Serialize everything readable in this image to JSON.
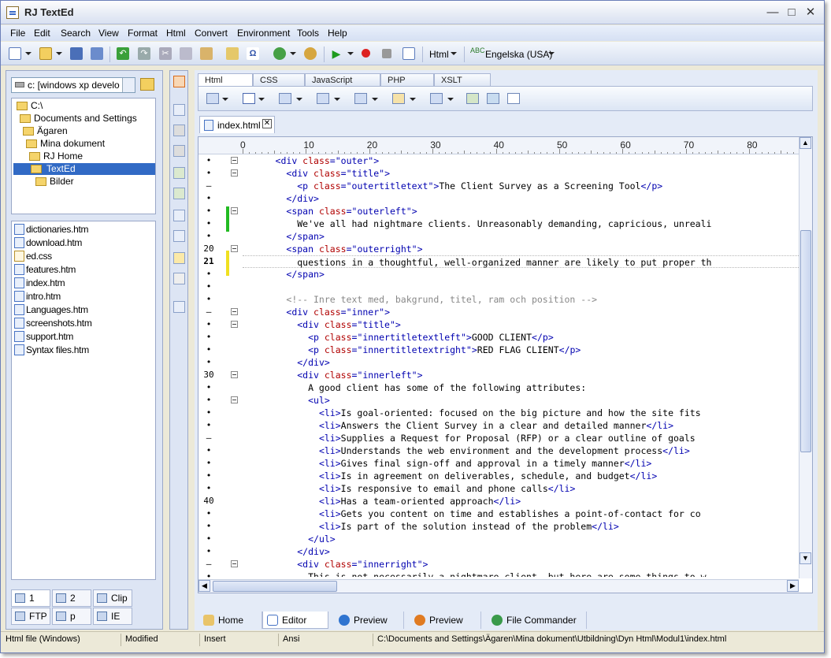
{
  "window": {
    "title": "RJ TextEd"
  },
  "menu": [
    "File",
    "Edit",
    "Search",
    "View",
    "Format",
    "Html",
    "Convert",
    "Environment",
    "Tools",
    "Help"
  ],
  "toolbar": {
    "mode_label": "Html",
    "language_label": "Engelska (USA)"
  },
  "left_panel": {
    "drive_value": "c: [windows xp develo",
    "tree": [
      "C:\\",
      "Documents and Settings",
      "Ägaren",
      "Mina dokument",
      "RJ Home",
      "TextEd",
      "Bilder"
    ],
    "tree_selected": "TextEd",
    "files": [
      "dictionaries.htm",
      "download.htm",
      "ed.css",
      "features.htm",
      "index.htm",
      "intro.htm",
      "Languages.htm",
      "screenshots.htm",
      "support.htm",
      "Syntax files.htm"
    ],
    "tabs": [
      "1",
      "2",
      "Clip",
      "FTP",
      "p",
      "IE"
    ]
  },
  "editor": {
    "panel_tabs": [
      "Html",
      "CSS",
      "JavaScript",
      "PHP",
      "XSLT"
    ],
    "active_panel_tab": "Html",
    "doc_tab": "index.html",
    "ruler_numbers": [
      "0",
      "10",
      "20",
      "30",
      "40",
      "50",
      "60",
      "70",
      "80"
    ],
    "gutter": [
      "•",
      "•",
      "–",
      "•",
      "•",
      "•",
      "•",
      "20",
      "21",
      "•",
      "•",
      "•",
      "–",
      "•",
      "•",
      "•",
      "•",
      "30",
      "•",
      "•",
      "•",
      "•",
      "–",
      "•",
      "•",
      "•",
      "•",
      "40",
      "•",
      "•",
      "•",
      "•",
      "–",
      "•"
    ],
    "current_line": "21",
    "code_lines": [
      "<div class=\"outer\">",
      "  <div class=\"title\">",
      "    <p class=\"outertitletext\">The Client Survey as a Screening Tool</p>",
      "  </div>",
      "  <span class=\"outerleft\">",
      "    We've all had nightmare clients. Unreasonably demanding, capricious, unreali",
      "  </span>",
      "  <span class=\"outerright\">",
      "    questions in a thoughtful, well-organized manner are likely to put proper th",
      "  </span>",
      "",
      "  <!-- Inre text med, bakgrund, titel, ram och position -->",
      "  <div class=\"inner\">",
      "    <div class=\"title\">",
      "      <p class=\"innertitletextleft\">GOOD CLIENT</p>",
      "      <p class=\"innertitletextright\">RED FLAG CLIENT</p>",
      "    </div>",
      "    <div class=\"innerleft\">",
      "      A good client has some of the following attributes:",
      "      <ul>",
      "        <li>Is goal-oriented: focused on the big picture and how the site fits",
      "        <li>Answers the Client Survey in a clear and detailed manner</li>",
      "        <li>Supplies a Request for Proposal (RFP) or a clear outline of goals",
      "        <li>Understands the web environment and the development process</li>",
      "        <li>Gives final sign-off and approval in a timely manner</li>",
      "        <li>Is in agreement on deliverables, schedule, and budget</li>",
      "        <li>Is responsive to email and phone calls</li>",
      "        <li>Has a team-oriented approach</li>",
      "        <li>Gets you content on time and establishes a point-of-contact for co",
      "        <li>Is part of the solution instead of the problem</li>",
      "      </ul>",
      "    </div>",
      "    <div class=\"innerright\">",
      "      This is not necessarily a nightmare client, but here are some things to w"
    ]
  },
  "bottom_tabs": [
    "Home",
    "Editor",
    "Preview",
    "Preview",
    "File Commander"
  ],
  "active_bottom_tab": "Editor",
  "status": {
    "file_type": "Html file (Windows)",
    "modified": "Modified",
    "insert": "Insert",
    "encoding": "Ansi",
    "path": "C:\\Documents and Settings\\Ägaren\\Mina dokument\\Utbildning\\Dyn Html\\Modul1\\index.html"
  },
  "colors": {
    "tag": "#0000b0",
    "attr": "#b00000",
    "comment": "#888888",
    "selection": "#316ac5",
    "change_mark_saved": "#22bb22",
    "change_mark_unsaved": "#f0e020"
  }
}
